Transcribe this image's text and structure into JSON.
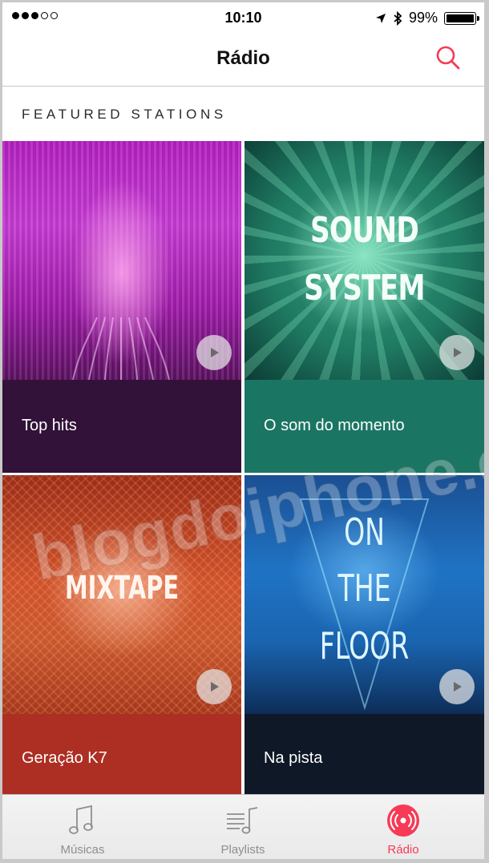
{
  "status_bar": {
    "time": "10:10",
    "battery": "99%",
    "battery_level": 0.99
  },
  "nav": {
    "title": "Rádio"
  },
  "section": {
    "title": "FEATURED STATIONS"
  },
  "stations": [
    {
      "name": "Top hits"
    },
    {
      "name": "O som do momento",
      "art_text": [
        "SOUND",
        "SYSTEM"
      ]
    },
    {
      "name": "Geração K7",
      "art_text": [
        "MIXTAPE"
      ]
    },
    {
      "name": "Na pista",
      "art_text": [
        "ON",
        "THE",
        "FLOOR"
      ]
    }
  ],
  "tabs": [
    {
      "label": "Músicas",
      "active": false
    },
    {
      "label": "Playlists",
      "active": false
    },
    {
      "label": "Rádio",
      "active": true
    }
  ],
  "watermark": "blogdoiphone.com",
  "colors": {
    "accent": "#f73a56",
    "tile1_bar": "#321239",
    "tile2_bar": "#1b7563",
    "tile3_bar": "#ad2e22",
    "tile4_bar": "#0e1827"
  }
}
